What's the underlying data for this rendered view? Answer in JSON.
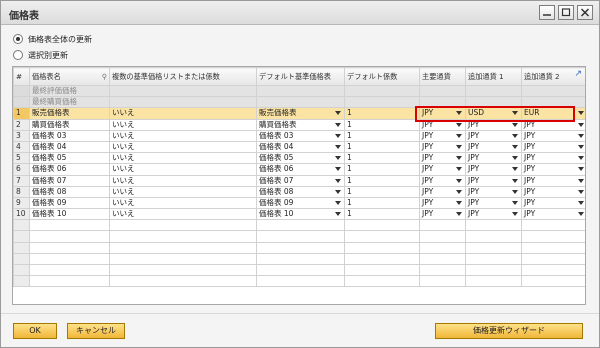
{
  "window": {
    "title": "価格表"
  },
  "radios": [
    {
      "label": "価格表全体の更新",
      "checked": true
    },
    {
      "label": "選択別更新",
      "checked": false
    }
  ],
  "table": {
    "headers": [
      "#",
      "価格表名",
      "複数の基準価格リストまたは係数",
      "デフォルト基準価格表",
      "デフォルト係数",
      "主要通貨",
      "追加通貨 1",
      "追加通貨 2"
    ],
    "special_rows": [
      "最終評価価格",
      "最終購買価格"
    ],
    "rows": [
      {
        "no": "1",
        "name": "販売価格表",
        "multi": "いいえ",
        "base": "販売価格表",
        "factor": "1",
        "cur1": "JPY",
        "cur2": "USD",
        "cur3": "EUR"
      },
      {
        "no": "2",
        "name": "購買価格表",
        "multi": "いいえ",
        "base": "購買価格表",
        "factor": "1",
        "cur1": "JPY",
        "cur2": "JPY",
        "cur3": "JPY"
      },
      {
        "no": "3",
        "name": "価格表 03",
        "multi": "いいえ",
        "base": "価格表 03",
        "factor": "1",
        "cur1": "JPY",
        "cur2": "JPY",
        "cur3": "JPY"
      },
      {
        "no": "4",
        "name": "価格表 04",
        "multi": "いいえ",
        "base": "価格表 04",
        "factor": "1",
        "cur1": "JPY",
        "cur2": "JPY",
        "cur3": "JPY"
      },
      {
        "no": "5",
        "name": "価格表 05",
        "multi": "いいえ",
        "base": "価格表 05",
        "factor": "1",
        "cur1": "JPY",
        "cur2": "JPY",
        "cur3": "JPY"
      },
      {
        "no": "6",
        "name": "価格表 06",
        "multi": "いいえ",
        "base": "価格表 06",
        "factor": "1",
        "cur1": "JPY",
        "cur2": "JPY",
        "cur3": "JPY"
      },
      {
        "no": "7",
        "name": "価格表 07",
        "multi": "いいえ",
        "base": "価格表 07",
        "factor": "1",
        "cur1": "JPY",
        "cur2": "JPY",
        "cur3": "JPY"
      },
      {
        "no": "8",
        "name": "価格表 08",
        "multi": "いいえ",
        "base": "価格表 08",
        "factor": "1",
        "cur1": "JPY",
        "cur2": "JPY",
        "cur3": "JPY"
      },
      {
        "no": "9",
        "name": "価格表 09",
        "multi": "いいえ",
        "base": "価格表 09",
        "factor": "1",
        "cur1": "JPY",
        "cur2": "JPY",
        "cur3": "JPY"
      },
      {
        "no": "10",
        "name": "価格表 10",
        "multi": "いいえ",
        "base": "価格表 10",
        "factor": "1",
        "cur1": "JPY",
        "cur2": "JPY",
        "cur3": "JPY"
      }
    ]
  },
  "buttons": {
    "ok": "OK",
    "cancel": "キャンセル",
    "wizard": "価格更新ウィザード"
  }
}
